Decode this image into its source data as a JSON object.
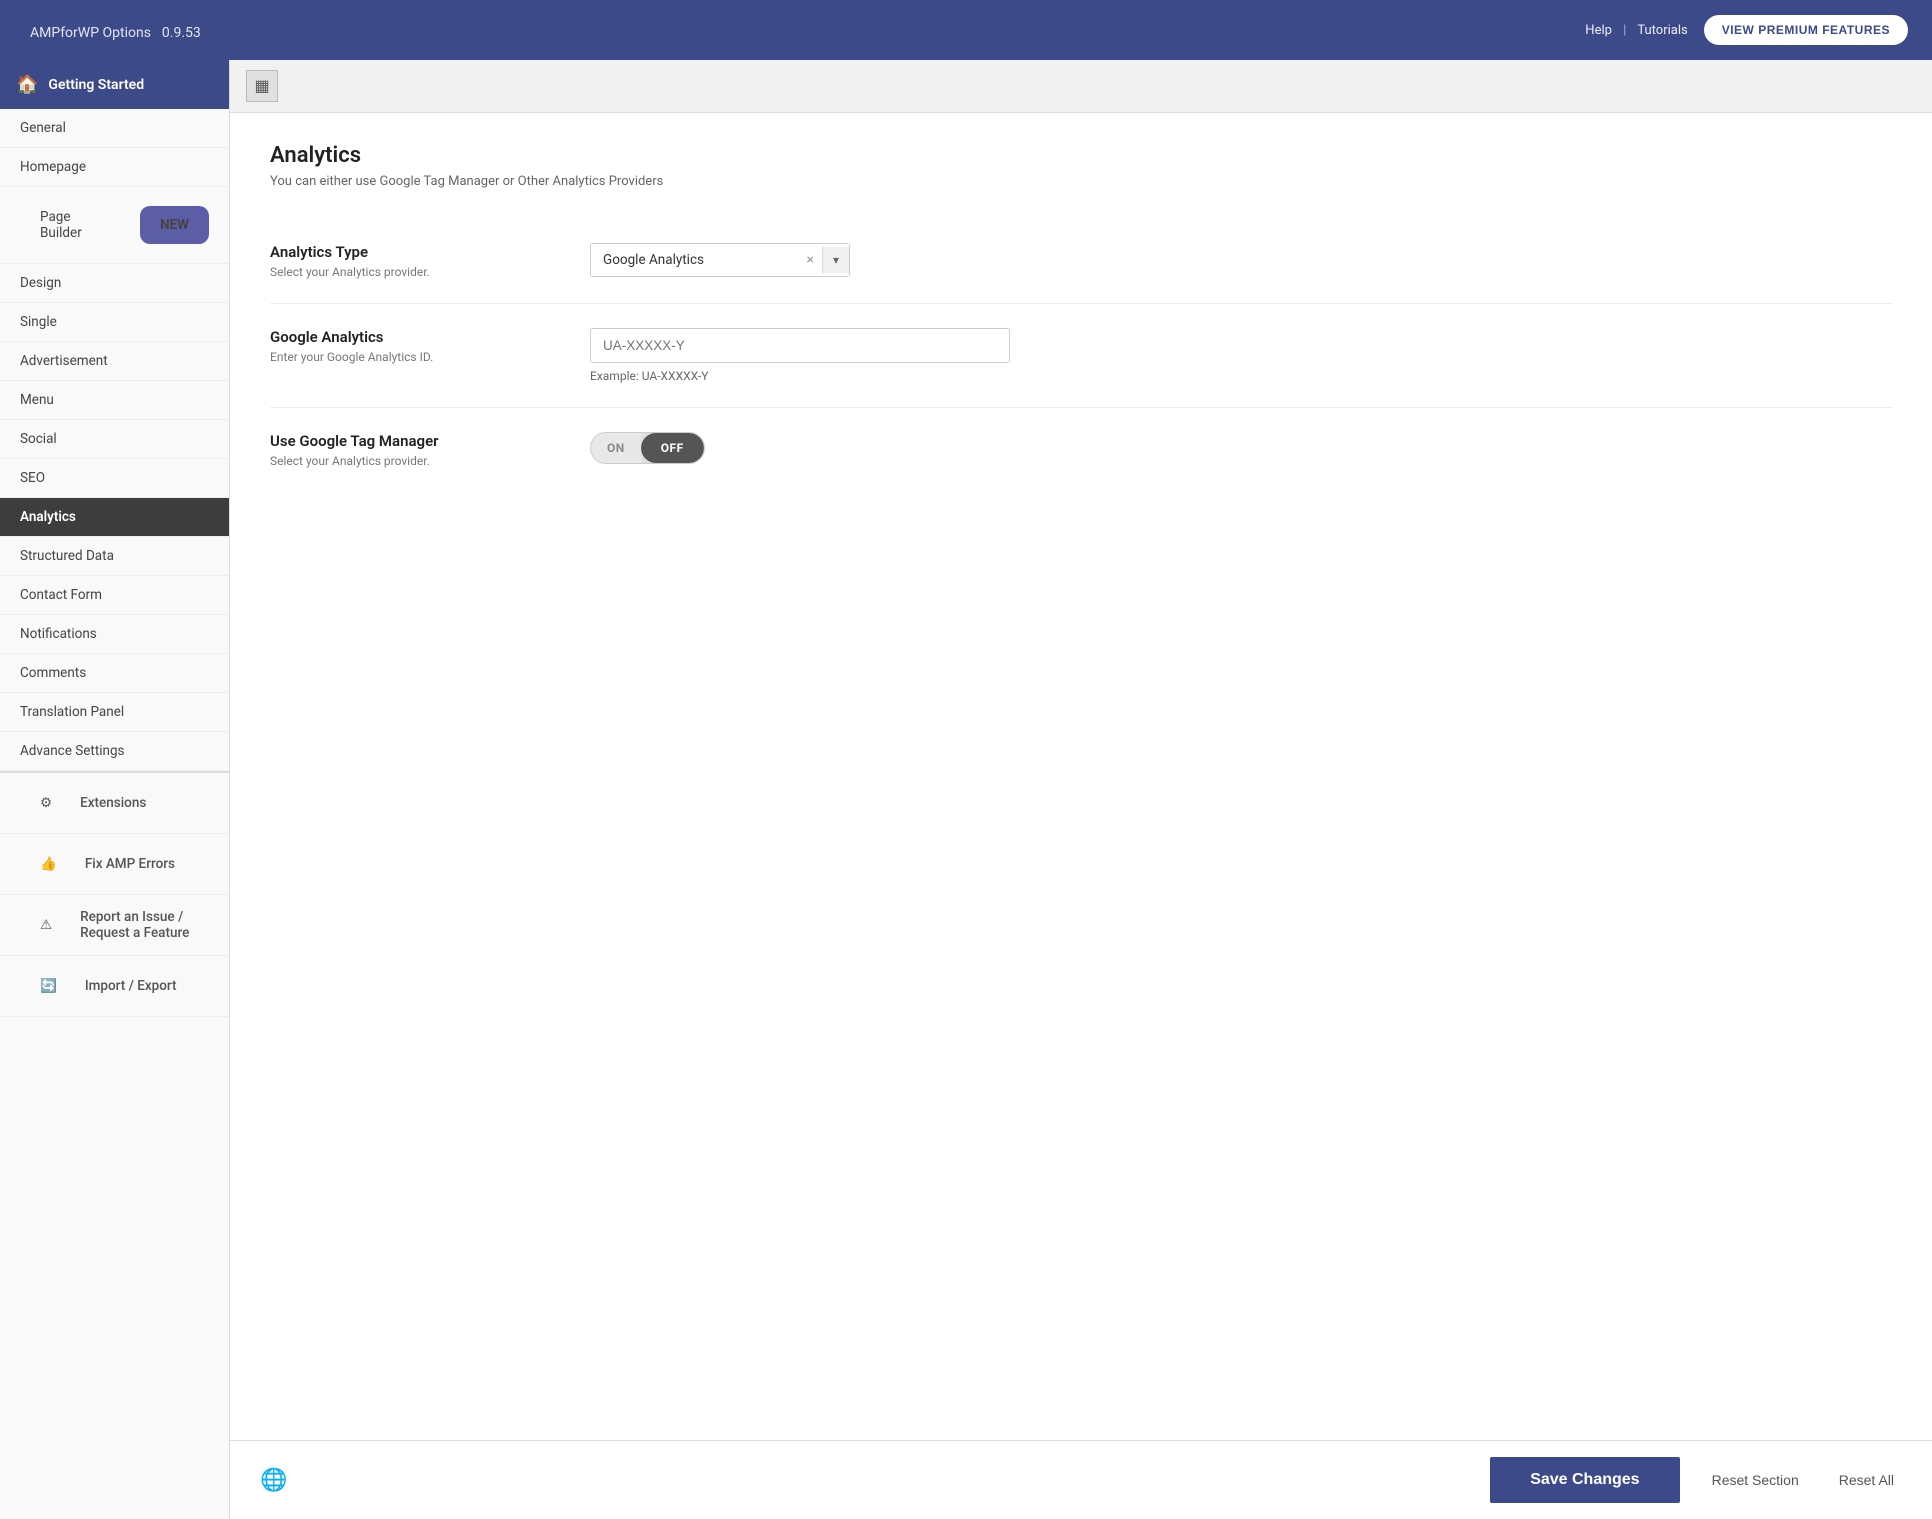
{
  "header": {
    "title": "AMPforWP Options",
    "version": "0.9.53",
    "help_label": "Help",
    "tutorials_label": "Tutorials",
    "premium_btn": "VIEW PREMIUM FEATURES"
  },
  "sidebar": {
    "getting_started": "Getting Started",
    "menu_items": [
      {
        "label": "General",
        "id": "general",
        "active": false
      },
      {
        "label": "Homepage",
        "id": "homepage",
        "active": false
      },
      {
        "label": "Page Builder",
        "id": "page-builder",
        "active": false,
        "badge": "NEW"
      },
      {
        "label": "Design",
        "id": "design",
        "active": false
      },
      {
        "label": "Single",
        "id": "single",
        "active": false
      },
      {
        "label": "Advertisement",
        "id": "advertisement",
        "active": false
      },
      {
        "label": "Menu",
        "id": "menu",
        "active": false
      },
      {
        "label": "Social",
        "id": "social",
        "active": false
      },
      {
        "label": "SEO",
        "id": "seo",
        "active": false
      },
      {
        "label": "Analytics",
        "id": "analytics",
        "active": true
      },
      {
        "label": "Structured Data",
        "id": "structured-data",
        "active": false
      },
      {
        "label": "Contact Form",
        "id": "contact-form",
        "active": false
      },
      {
        "label": "Notifications",
        "id": "notifications",
        "active": false
      },
      {
        "label": "Comments",
        "id": "comments",
        "active": false
      },
      {
        "label": "Translation Panel",
        "id": "translation-panel",
        "active": false
      },
      {
        "label": "Advance Settings",
        "id": "advance-settings",
        "active": false
      }
    ],
    "section_items": [
      {
        "label": "Extensions",
        "id": "extensions",
        "icon": "⚙"
      },
      {
        "label": "Fix AMP Errors",
        "id": "fix-amp-errors",
        "icon": "👍"
      },
      {
        "label": "Report an Issue / Request a Feature",
        "id": "report-issue",
        "icon": "⚠"
      },
      {
        "label": "Import / Export",
        "id": "import-export",
        "icon": "🔄"
      }
    ]
  },
  "main": {
    "section_title": "Analytics",
    "section_desc": "You can either use Google Tag Manager or Other Analytics Providers",
    "rows": [
      {
        "id": "analytics-type",
        "label": "Analytics Type",
        "sublabel": "Select your Analytics provider.",
        "control": "select",
        "value": "Google Analytics"
      },
      {
        "id": "google-analytics",
        "label": "Google Analytics",
        "sublabel": "Enter your Google Analytics ID.",
        "control": "input",
        "placeholder": "UA-XXXXX-Y",
        "example": "Example: UA-XXXXX-Y"
      },
      {
        "id": "google-tag-manager",
        "label": "Use Google Tag Manager",
        "sublabel": "Select your Analytics provider.",
        "control": "toggle",
        "on_label": "ON",
        "off_label": "OFF",
        "state": "off"
      }
    ]
  },
  "footer": {
    "save_label": "Save Changes",
    "reset_section_label": "Reset Section",
    "reset_all_label": "Reset All"
  }
}
